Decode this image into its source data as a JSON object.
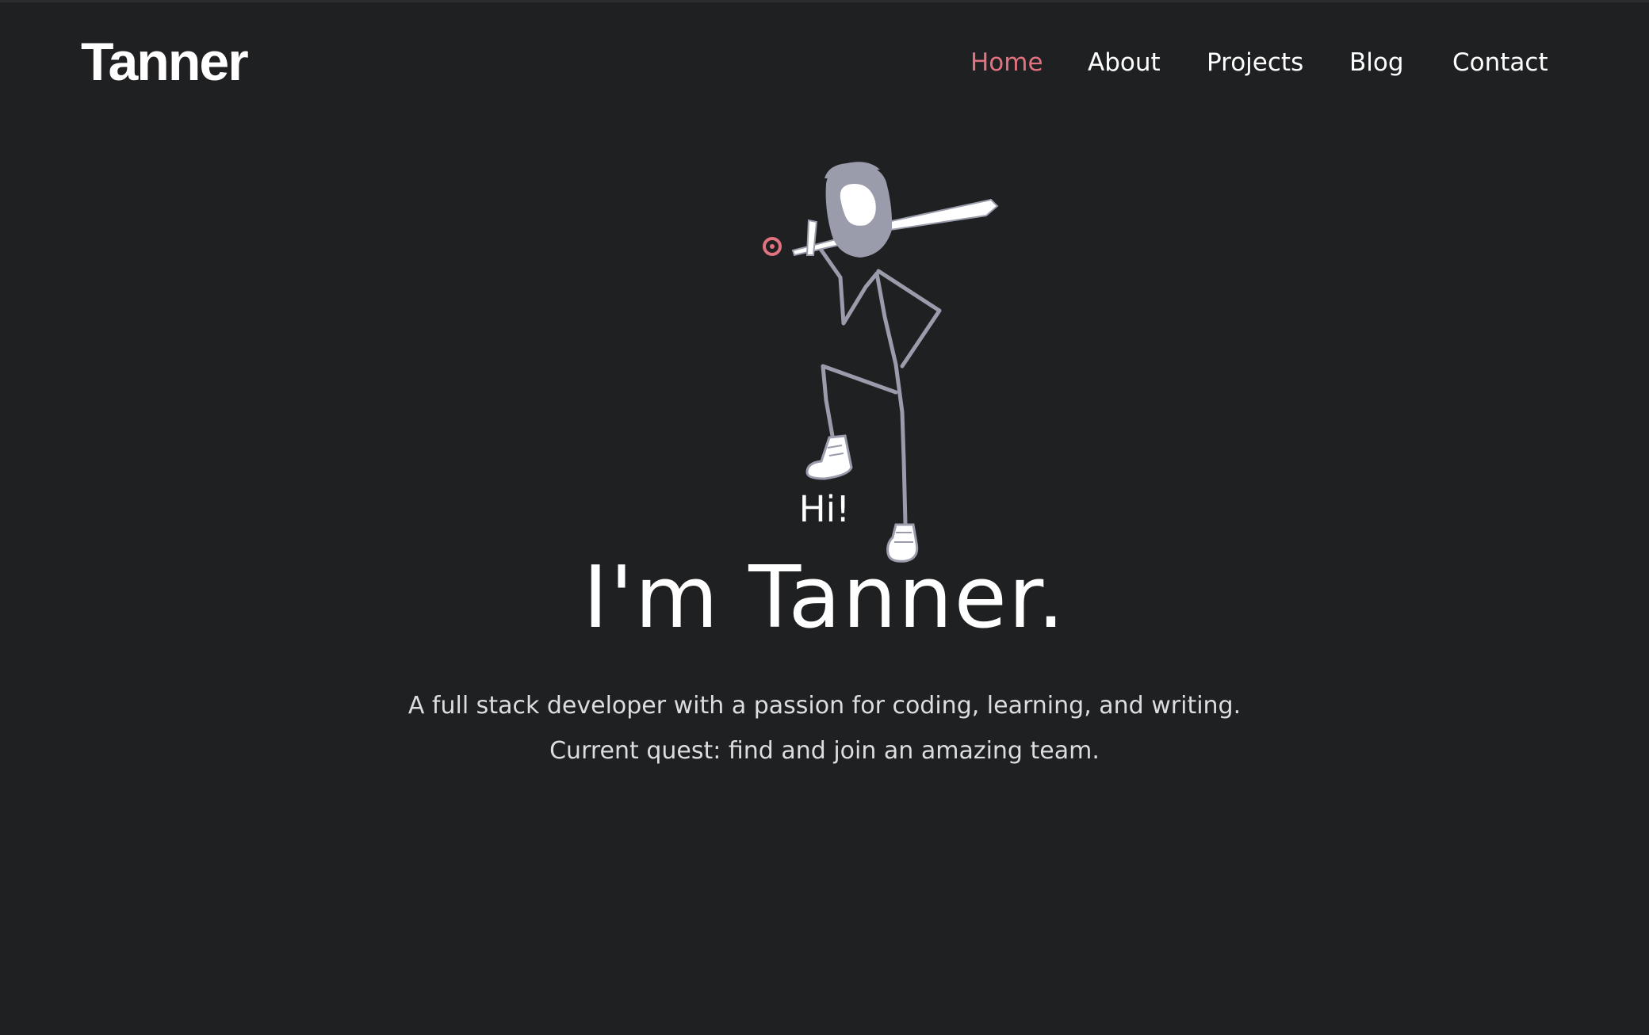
{
  "header": {
    "logo_text": "Tanner"
  },
  "nav": {
    "items": [
      {
        "label": "Home",
        "active": true
      },
      {
        "label": "About",
        "active": false
      },
      {
        "label": "Projects",
        "active": false
      },
      {
        "label": "Blog",
        "active": false
      },
      {
        "label": "Contact",
        "active": false
      }
    ]
  },
  "hero": {
    "greeting": "Hi!",
    "headline": "I'm Tanner.",
    "tagline_line1": "A full stack developer with a passion for coding, learning, and writing.",
    "tagline_line2": "Current quest: find and join an amazing team.",
    "illustration": "stick-figure-with-sword-icon"
  },
  "colors": {
    "background": "#1f2022",
    "text": "#ffffff",
    "accent": "#e2727f",
    "muted_text": "#dcdde0",
    "figure_gray": "#9a9cab"
  }
}
